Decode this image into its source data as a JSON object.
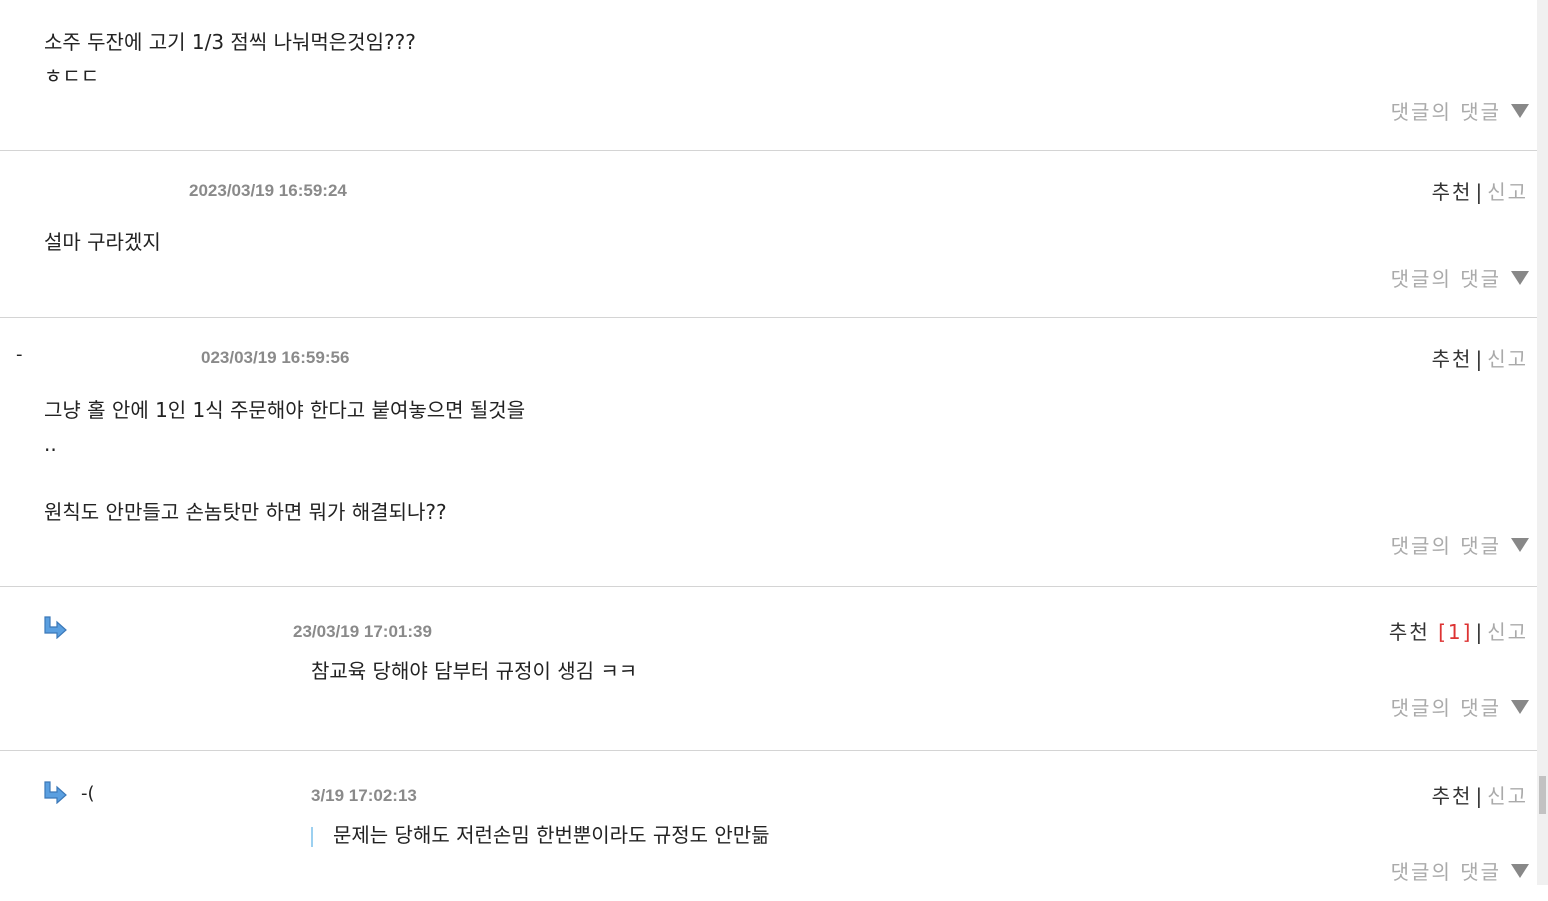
{
  "comments": [
    {
      "body": "소주 두잔에 고기 1/3 점씩 나눠먹은것임???\nㅎㄷㄷ",
      "reply_toggle": "댓글의 댓글"
    },
    {
      "date": "2023/03/19 16:59:24",
      "recommend": "추천",
      "separator": "|",
      "report": "신고",
      "body": "설마 구라겠지",
      "reply_toggle": "댓글의 댓글"
    },
    {
      "nick_fragment": "-",
      "date": "023/03/19 16:59:56",
      "recommend": "추천",
      "separator": "|",
      "report": "신고",
      "body": "그냥 홀 안에 1인 1식 주문해야 한다고 붙여놓으면 될것을\n..\n\n원칙도 안만들고 손놈탓만 하면 뭐가 해결되나??",
      "reply_toggle": "댓글의 댓글"
    },
    {
      "date": "23/03/19 17:01:39",
      "recommend": "추천",
      "recommend_count": "[1]",
      "separator": "|",
      "report": "신고",
      "body": "참교육 당해야 담부터 규정이 생김 ㅋㅋ",
      "reply_toggle": "댓글의 댓글"
    },
    {
      "nick_fragment": "-(",
      "date": "3/19 17:02:13",
      "recommend": "추천",
      "separator": "|",
      "report": "신고",
      "body": "문제는 당해도 저런손밈 한번뿐이라도 규정도 안만듦",
      "reply_toggle": "댓글의 댓글"
    }
  ]
}
